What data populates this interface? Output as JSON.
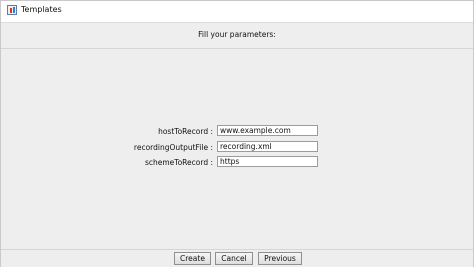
{
  "window": {
    "title": "Templates",
    "icon": "java-app-icon"
  },
  "header": {
    "text": "Fill your parameters:"
  },
  "form": {
    "fields": [
      {
        "label": "hostToRecord :",
        "value": "www.example.com"
      },
      {
        "label": "recordingOutputFile :",
        "value": "recording.xml"
      },
      {
        "label": "schemeToRecord :",
        "value": "https"
      }
    ]
  },
  "buttons": {
    "create": "Create",
    "cancel": "Cancel",
    "previous": "Previous"
  }
}
